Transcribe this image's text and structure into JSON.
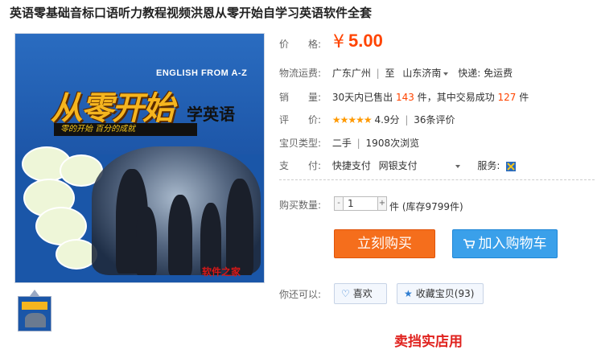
{
  "title": "英语零基础音标口语听力教程视频洪恩从零开始自学习英语软件全套",
  "image": {
    "en_text": "ENGLISH FROM A-Z",
    "big_text": "从零开始",
    "sub_text": "学英语",
    "slogan": "零的开始 百分的成就",
    "stamp": "软件之家"
  },
  "price": {
    "label": "价　　格:",
    "symbol": "¥",
    "value": "5.00"
  },
  "shipping": {
    "label": "物流运费:",
    "from": "广东广州",
    "to_word": "至",
    "to": "山东济南",
    "method": "快递: 免运费"
  },
  "sales": {
    "label": "销　　量:",
    "prefix": "30天内已售出",
    "sold": "143",
    "unit": "件",
    "mid": "，其中交易成功",
    "success": "127",
    "unit2": "件"
  },
  "rating": {
    "label": "评　　价:",
    "stars": "★★★★★",
    "score": "4.9分",
    "reviews": "36条评价"
  },
  "type": {
    "label": "宝贝类型:",
    "condition": "二手",
    "views": "1908次浏览"
  },
  "payment": {
    "label": "支　　付:",
    "method1": "快捷支付",
    "method2": "网银支付",
    "service_label": "服务:"
  },
  "quantity": {
    "label": "购买数量:",
    "value": "1",
    "minus": "-",
    "plus": "+",
    "stock": "件 (库存9799件)"
  },
  "buttons": {
    "buy": "立刻购买",
    "cart": "加入购物车"
  },
  "also": {
    "label": "你还可以:",
    "like": "喜欢",
    "favorite": "收藏宝贝(93)"
  },
  "bottom_text": "卖挡实店用",
  "colors": {
    "price": "#ff4400",
    "buy": "#f56e1c",
    "cart": "#3aa0ea",
    "accent_blue": "#2e7dd1"
  }
}
